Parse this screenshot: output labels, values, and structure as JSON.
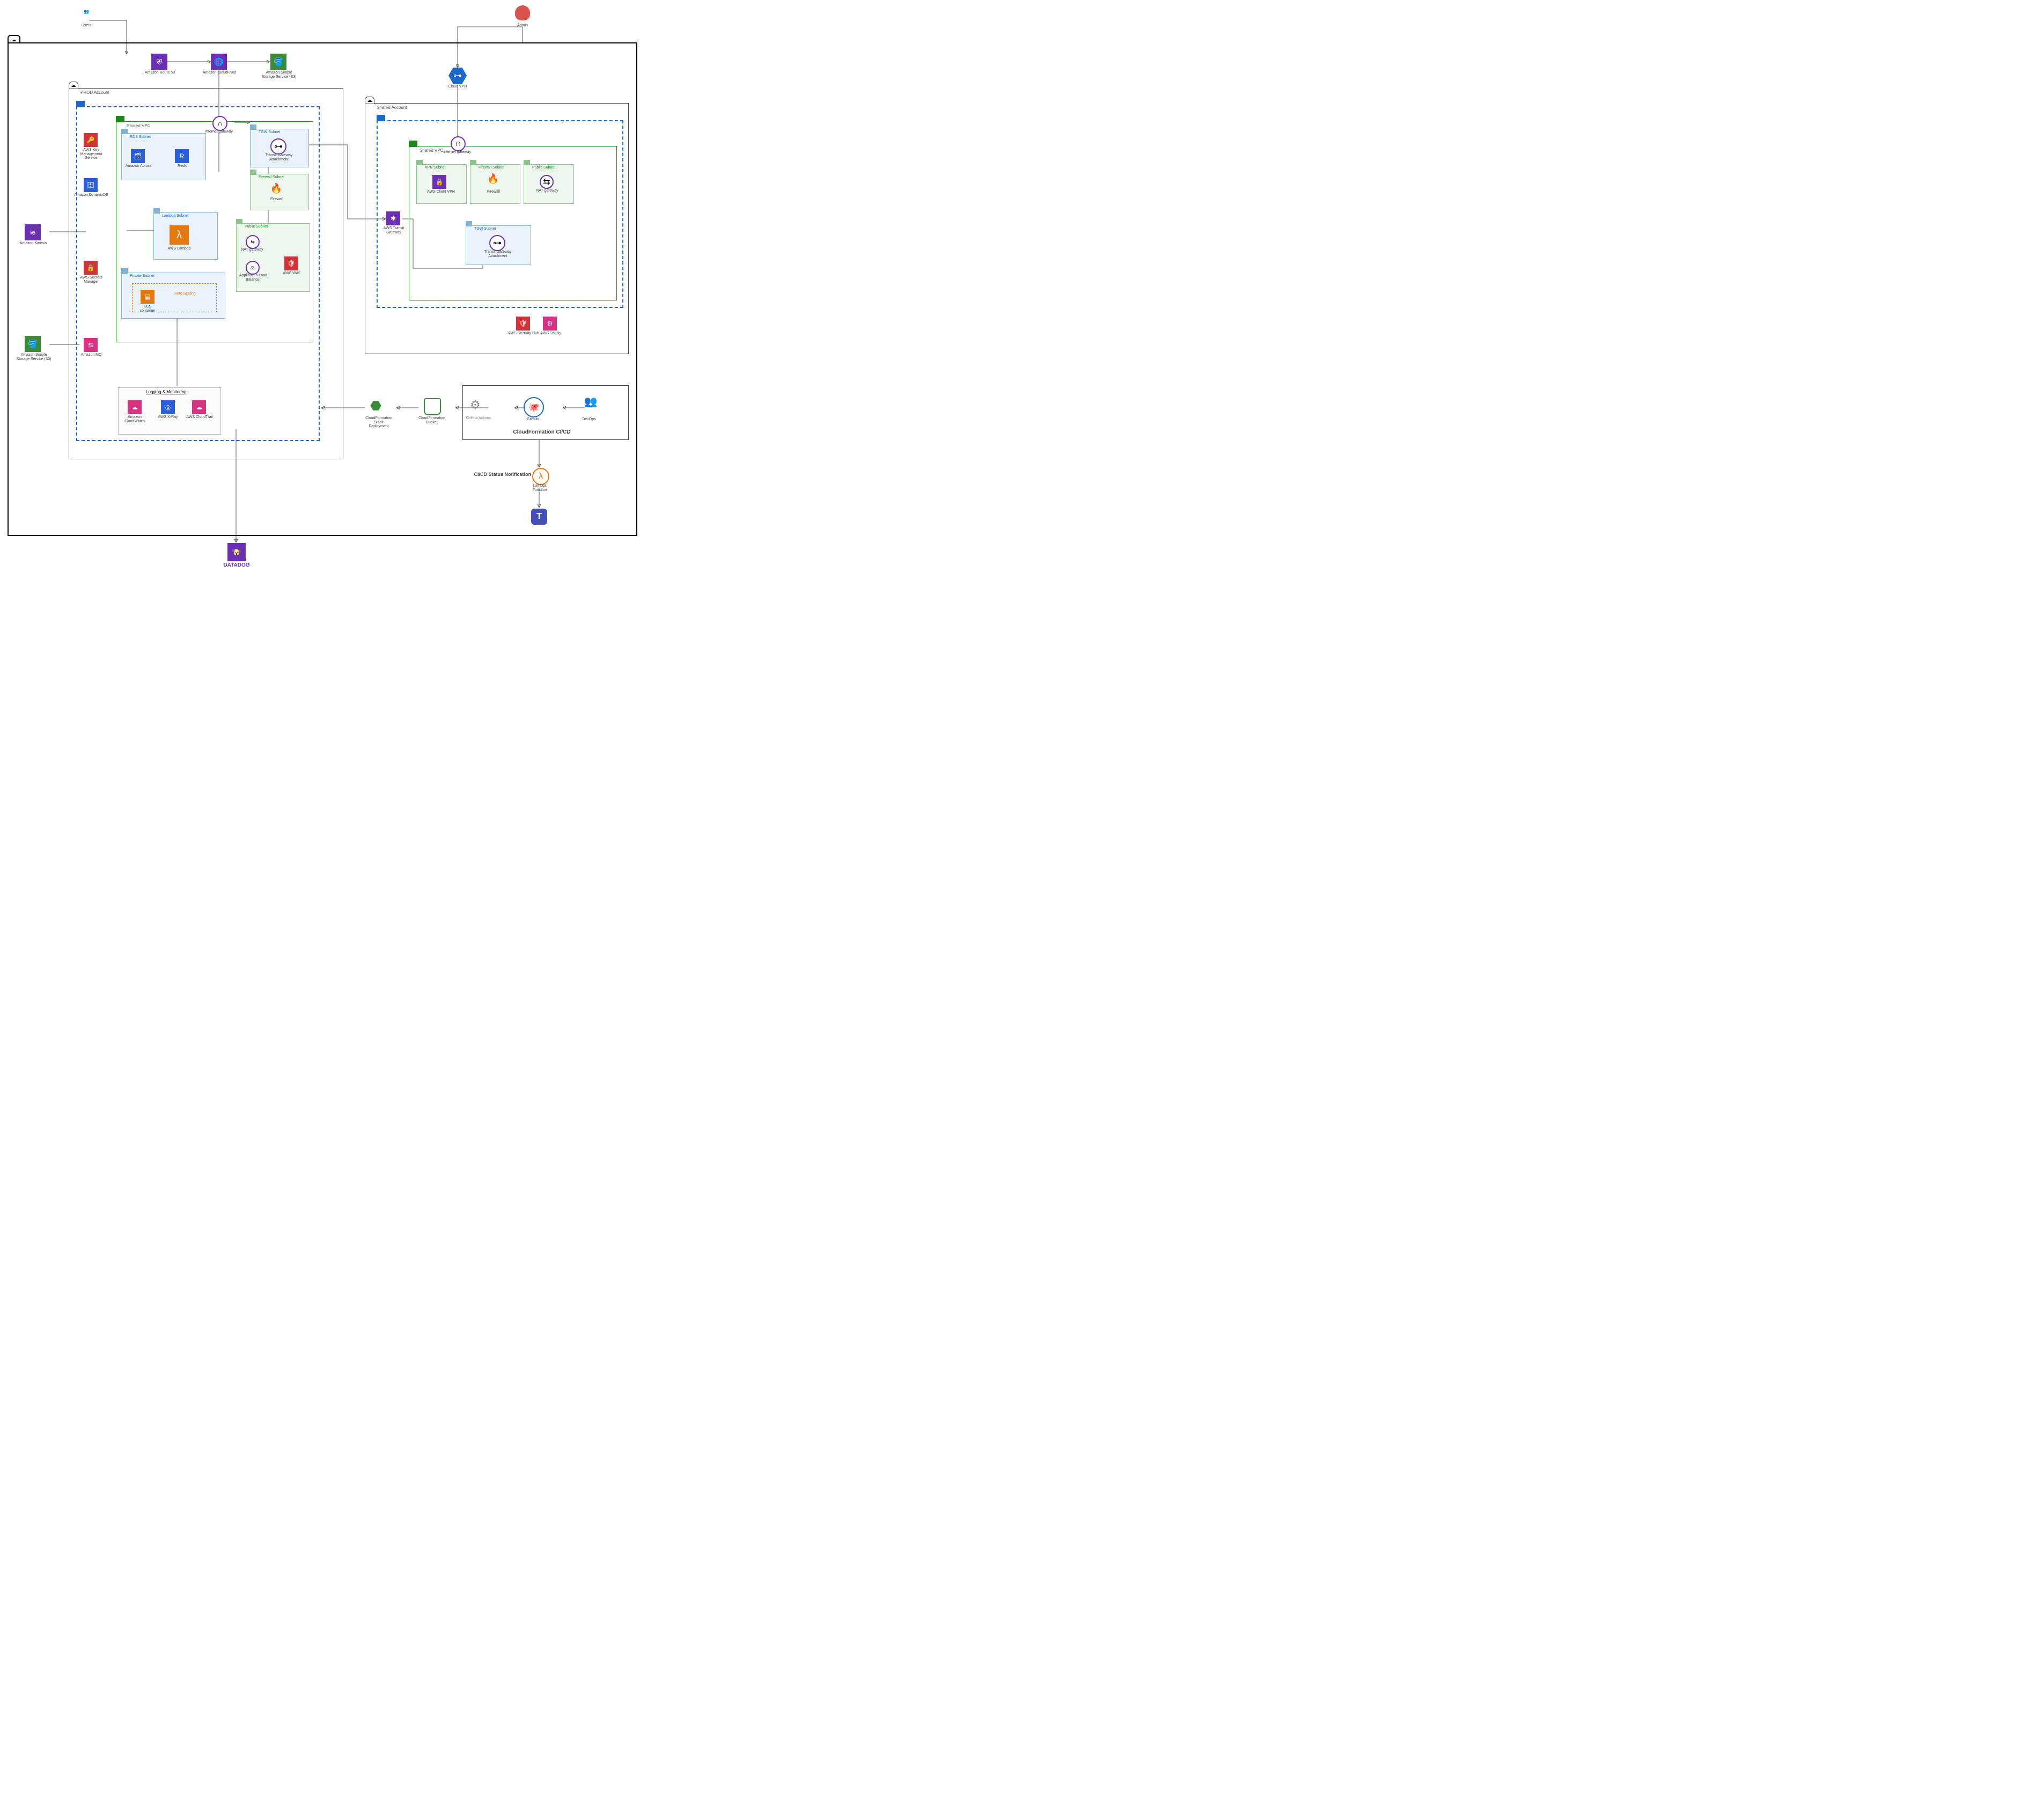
{
  "actors": {
    "users": "Users",
    "admin": "Admin",
    "devops": "DevOps"
  },
  "top": {
    "route53": "Amazon Route 53",
    "cloudfront": "Amazon CloudFront",
    "s3": "Amazon Simple\nStorage Service (S3)",
    "cloudvpn": "Cloud VPN"
  },
  "accounts": {
    "prod": "PROD Account",
    "shared": "Shared Account"
  },
  "vpc": {
    "shared": "Shared VPC"
  },
  "prod": {
    "igw": "Internet gateway",
    "subnets": {
      "rds": "RDS Subnet",
      "tgw": "TGW Subnet",
      "firewall": "Firewall Subnet",
      "lambda": "Lambda Subnet",
      "public": "Public Subnet",
      "private": "Private Subnet"
    },
    "services": {
      "kms": "AWS Key\nManagement Service",
      "dynamo": "Amazon DynamoDB",
      "secrets": "AWS Secrets\nManager",
      "mq": "Amazon MQ",
      "aurora": "Amazon Aurora",
      "redis": "Redis",
      "lambda": "AWS Lambda",
      "tgwatt": "Transit Gateway\nAttachment",
      "firewall": "Firewall",
      "nat": "NAT gateway",
      "alb": "Application Load\nBalancer",
      "waf": "AWS WAF",
      "ecs": "ECS\ncontainer",
      "autoscale": "Auto Scaling"
    }
  },
  "left": {
    "kinesis": "Amazon Kinesis",
    "s3": "Amazon Simple\nStorage Service (S3)"
  },
  "shared": {
    "igw": "Internet gateway",
    "tgw": "AWS Transit Gateway",
    "subnets": {
      "vpn": "VPN Subnet",
      "firewall": "Firewall Subnet",
      "public": "Public Subnet",
      "tgw": "TGW Subnet"
    },
    "services": {
      "clientvpn": "AWS Client VPN",
      "firewall": "Firewall",
      "nat": "NAT gateway",
      "tgwatt": "Transit Gateway\nAttachment",
      "sechub": "AWS Security Hub",
      "config": "AWS Config"
    }
  },
  "logging": {
    "title": "Logging & Monitoring",
    "cw": "Amazon CloudWatch",
    "xray": "AWS X-Ray",
    "cloudtrail": "AWS CloudTrail"
  },
  "cicd": {
    "title": "CloudFormation CI/CD",
    "stack": "CloudFormation\nStack\nDeployment",
    "bucket": "CloudFormation\nBucket",
    "gha": "GitHub Actions",
    "github": "GitHub",
    "status": "CI/CD  Status Notification",
    "lambda": "Lambda\nFunction"
  },
  "bottom": {
    "datadog": "DATADOG"
  }
}
